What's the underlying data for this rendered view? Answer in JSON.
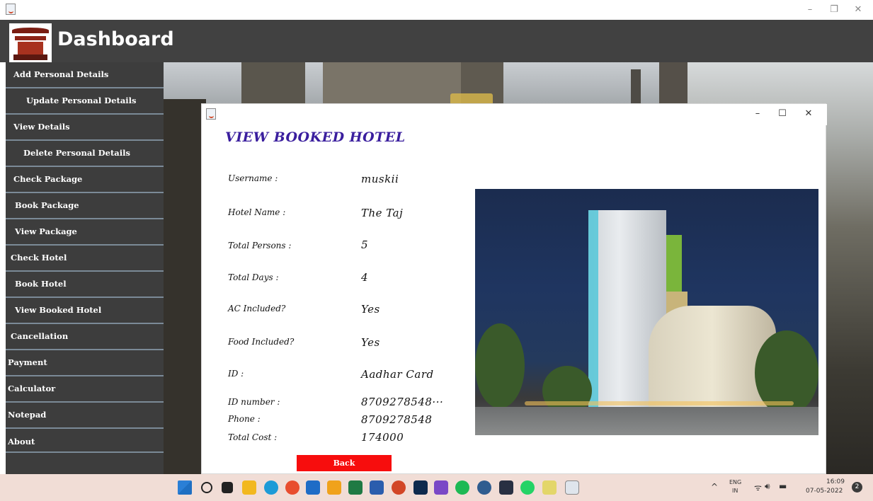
{
  "window": {
    "controls": {
      "minimize": "–",
      "restore": "❐",
      "close": "✕"
    }
  },
  "header": {
    "title": "Dashboard"
  },
  "sidebar": {
    "items": [
      {
        "label": "Add Personal Details"
      },
      {
        "label": "Update Personal Details"
      },
      {
        "label": "View Details"
      },
      {
        "label": "Delete Personal Details"
      },
      {
        "label": "Check Package"
      },
      {
        "label": "Book Package"
      },
      {
        "label": "View Package"
      },
      {
        "label": "Check Hotel"
      },
      {
        "label": "Book Hotel"
      },
      {
        "label": "View Booked Hotel"
      },
      {
        "label": "Cancellation"
      },
      {
        "label": "Payment"
      },
      {
        "label": "Calculator"
      },
      {
        "label": "Notepad"
      },
      {
        "label": "About"
      }
    ]
  },
  "dialog": {
    "controls": {
      "minimize": "–",
      "maximize": "☐",
      "close": "✕"
    },
    "title": "VIEW BOOKED HOTEL",
    "fields": [
      {
        "label": "Username :",
        "value": "muskii"
      },
      {
        "label": "Hotel Name :",
        "value": "The Taj"
      },
      {
        "label": "Total Persons :",
        "value": "5"
      },
      {
        "label": "Total Days :",
        "value": "4"
      },
      {
        "label": "AC Included?",
        "value": "Yes"
      },
      {
        "label": "Food Included?",
        "value": "Yes"
      },
      {
        "label": "ID :",
        "value": "Aadhar Card"
      },
      {
        "label": "ID number :",
        "value": "8709278548···"
      },
      {
        "label": "Phone :",
        "value": "8709278548"
      },
      {
        "label": "Total Cost :",
        "value": "174000"
      }
    ],
    "back_label": "Back"
  },
  "taskbar": {
    "tray": {
      "lang": "ENG",
      "region": "IN",
      "time": "16:09",
      "date": "07-05-2022",
      "notifications": "2",
      "chevron": "^"
    }
  }
}
